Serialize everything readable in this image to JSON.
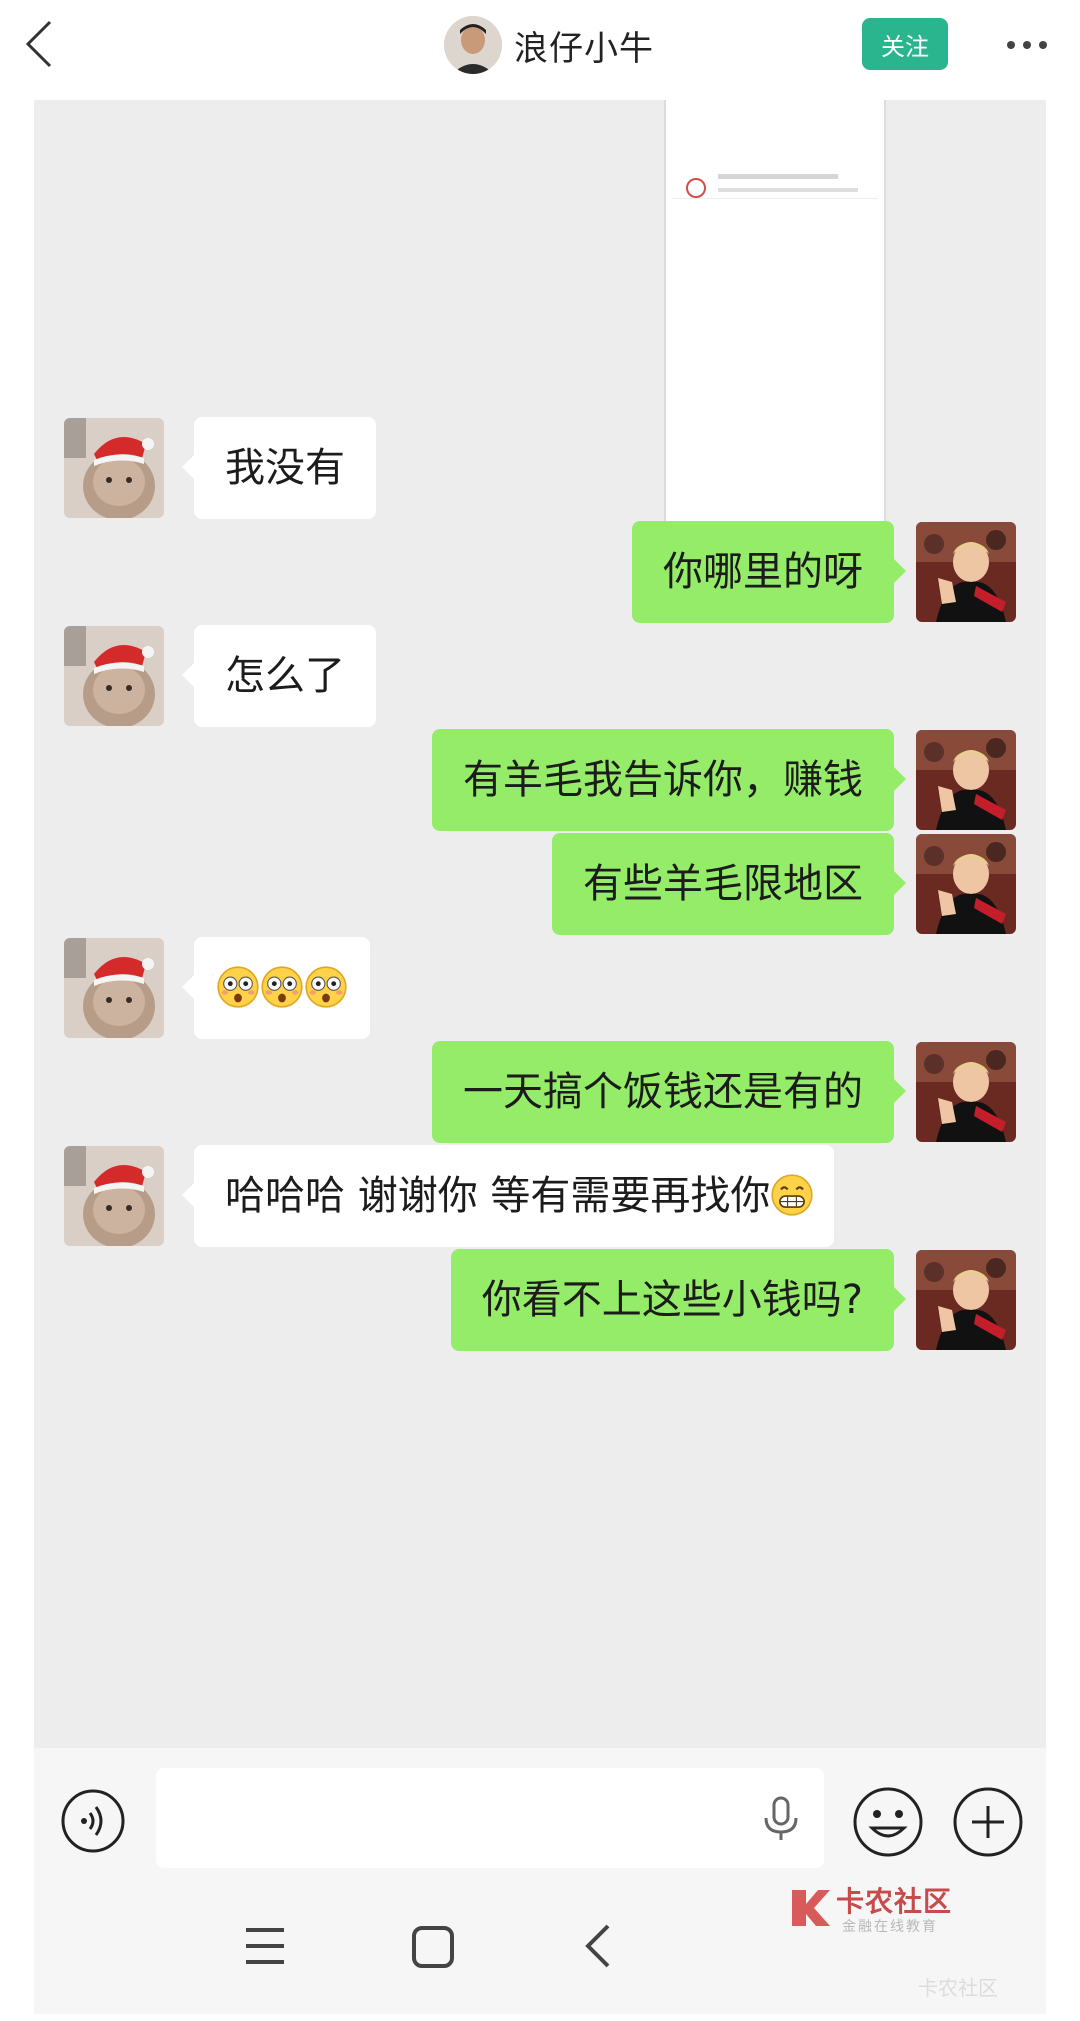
{
  "header": {
    "author_name": "浪仔小牛",
    "follow_label": "关注"
  },
  "messages": [
    {
      "side": "left",
      "text": "我没有"
    },
    {
      "side": "right",
      "text": "你哪里的呀"
    },
    {
      "side": "left",
      "text": "怎么了"
    },
    {
      "side": "right",
      "text": "有羊毛我告诉你，赚钱"
    },
    {
      "side": "right",
      "text": "有些羊毛限地区"
    },
    {
      "side": "left",
      "emoji": [
        "flushed-face",
        "flushed-face",
        "flushed-face"
      ]
    },
    {
      "side": "right",
      "text": "一天搞个饭钱还是有的"
    },
    {
      "side": "left",
      "text": "哈哈哈 谢谢你 等有需要再找你",
      "emoji_suffix": "grinning-face"
    },
    {
      "side": "right",
      "text": "你看不上这些小钱吗?"
    }
  ],
  "input": {
    "value": "",
    "placeholder": ""
  },
  "watermark": {
    "title": "卡农社区",
    "subtitle": "金融在线教育",
    "faint": "卡农社区"
  },
  "colors": {
    "follow_button": "#2bb58f",
    "chat_background": "#ededed",
    "outgoing_bubble": "#95ec69",
    "incoming_bubble": "#ffffff"
  }
}
